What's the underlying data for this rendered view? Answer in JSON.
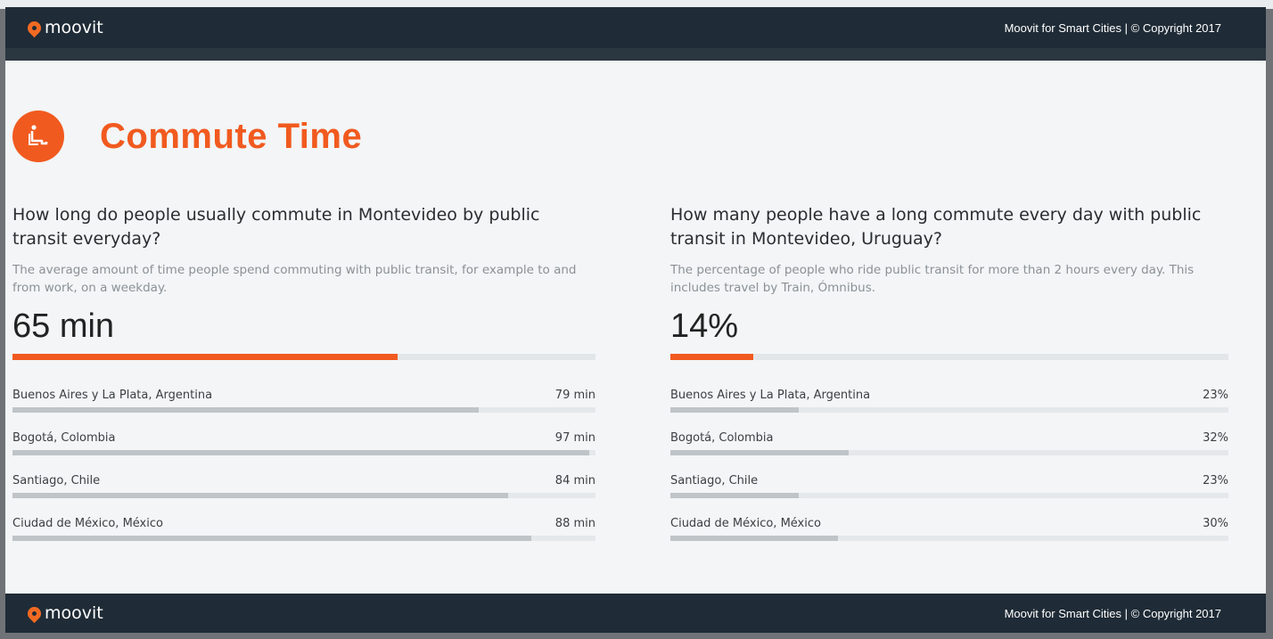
{
  "header": {
    "brand": "moovit",
    "meta": "Moovit for Smart Cities  |  © Copyright 2017"
  },
  "footer": {
    "brand": "moovit",
    "meta": "Moovit for Smart Cities  |  © Copyright 2017"
  },
  "section": {
    "title": "Commute Time",
    "icon": "seated-person-icon"
  },
  "colors": {
    "accent": "#f15a1f",
    "bar_bg": "#1f2b36",
    "track": "#e3e6e8",
    "compare_fill": "#bfc4c8"
  },
  "left": {
    "question": "How long do people usually commute in Montevideo by public transit everyday?",
    "description": "The average amount of time people spend commuting with public transit, for example to and from work, on a weekday.",
    "value": "65 min",
    "fraction": 0.66,
    "rows": [
      {
        "city": "Buenos Aires y La Plata, Argentina",
        "value": "79 min",
        "fraction": 0.8
      },
      {
        "city": "Bogotá, Colombia",
        "value": "97 min",
        "fraction": 0.99
      },
      {
        "city": "Santiago, Chile",
        "value": "84 min",
        "fraction": 0.85
      },
      {
        "city": "Ciudad de México, México",
        "value": "88 min",
        "fraction": 0.89
      }
    ]
  },
  "right": {
    "question": "How many people have a long commute every day with public transit in Montevideo, Uruguay?",
    "description": "The percentage of people who ride public transit for more than 2 hours every day. This includes travel by Train, Ómnibus.",
    "value": "14%",
    "fraction": 0.148,
    "rows": [
      {
        "city": "Buenos Aires y La Plata, Argentina",
        "value": "23%",
        "fraction": 0.23
      },
      {
        "city": "Bogotá, Colombia",
        "value": "32%",
        "fraction": 0.32
      },
      {
        "city": "Santiago, Chile",
        "value": "23%",
        "fraction": 0.23
      },
      {
        "city": "Ciudad de México, México",
        "value": "30%",
        "fraction": 0.3
      }
    ]
  }
}
